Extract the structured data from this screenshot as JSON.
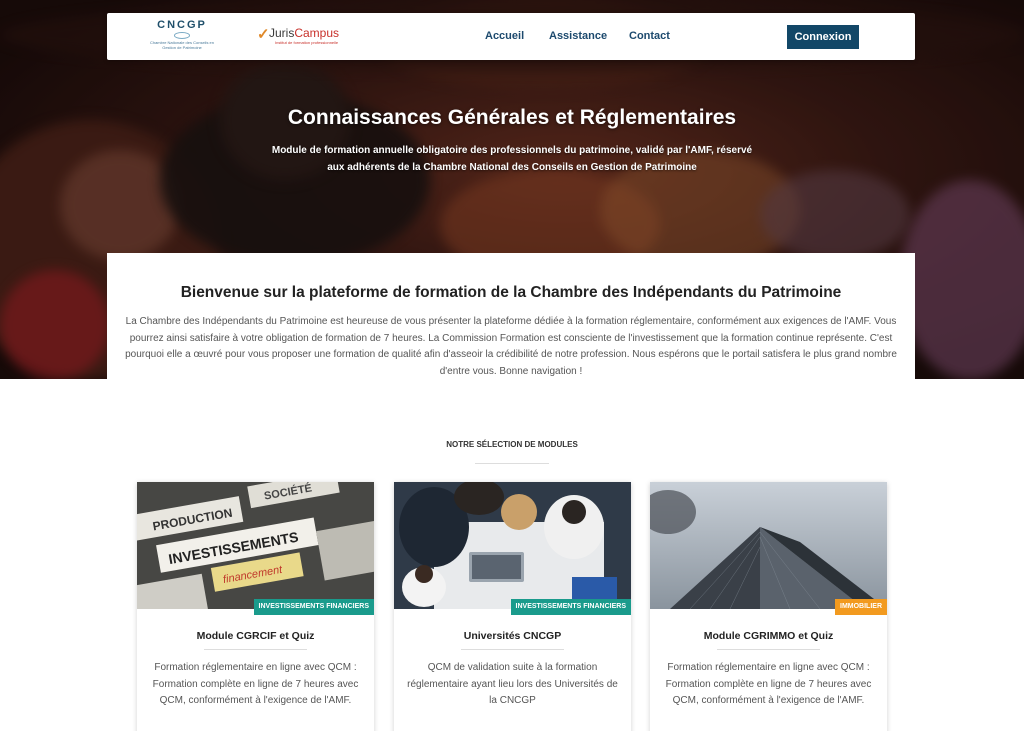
{
  "header": {
    "logo_cncgp": "CNCGP",
    "logo_cncgp_sub": "Chambre Nationale des Conseils en Gestion de Patrimoine",
    "logo_juris_a": "Juris",
    "logo_juris_b": "Campus",
    "logo_juris_tag": "Institut de formation professionnelle",
    "nav": [
      {
        "label": "Accueil"
      },
      {
        "label": "Assistance"
      },
      {
        "label": "Contact"
      }
    ],
    "login_label": "Connexion"
  },
  "hero": {
    "title": "Connaissances Générales et Réglementaires",
    "subtitle": "Module de formation annuelle obligatoire des professionnels du patrimoine, validé par l'AMF, réservé aux adhérents de la Chambre National des Conseils en Gestion de Patrimoine"
  },
  "welcome": {
    "title": "Bienvenue sur la plateforme de formation de la Chambre des Indépendants du Patrimoine",
    "body": "La Chambre des Indépendants du Patrimoine est heureuse de vous présenter la plateforme dédiée à la formation réglementaire, conformément aux exigences de l'AMF. Vous pourrez ainsi satisfaire à votre obligation de formation de 7 heures. La Commission Formation est consciente de l'investissement que la formation continue représente. C'est pourquoi elle a œuvré pour vous proposer une formation de qualité afin d'asseoir la crédibilité de notre profession. Nous espérons que le portail satisfera le plus grand nombre d'entre vous. Bonne navigation !"
  },
  "modules": {
    "section_title": "NOTRE SÉLECTION DE MODULES",
    "items": [
      {
        "badge": "INVESTISSEMENTS FINANCIERS",
        "badge_color": "#1a9b8c",
        "title": "Module CGRCIF et Quiz",
        "description": "Formation réglementaire en ligne avec QCM : Formation complète en ligne de 7 heures avec QCM, conformément à l'exigence de l'AMF.",
        "image_words": [
          "PRODUCTION",
          "SOCIÉTÉ",
          "INVESTISSEMENTS",
          "financement"
        ]
      },
      {
        "badge": "INVESTISSEMENTS FINANCIERS",
        "badge_color": "#1a9b8c",
        "title": "Universités CNCGP",
        "description": "QCM de validation suite à la formation réglementaire ayant lieu lors des Universités de la CNCGP"
      },
      {
        "badge": "IMMOBILIER",
        "badge_color": "#f29a1f",
        "title": "Module CGRIMMO et Quiz",
        "description": "Formation réglementaire en ligne avec QCM : Formation complète en ligne de 7 heures avec QCM, conformément à l'exigence de l'AMF."
      }
    ]
  }
}
